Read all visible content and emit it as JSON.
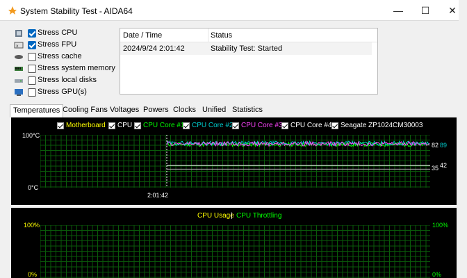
{
  "window": {
    "title": "System Stability Test - AIDA64",
    "minimize": "—",
    "maximize": "☐",
    "close": "✕"
  },
  "options": [
    {
      "label": "Stress CPU",
      "checked": true,
      "icon": "cpu-icon"
    },
    {
      "label": "Stress FPU",
      "checked": true,
      "icon": "fpu-icon"
    },
    {
      "label": "Stress cache",
      "checked": false,
      "icon": "cache-icon"
    },
    {
      "label": "Stress system memory",
      "checked": false,
      "icon": "memory-icon"
    },
    {
      "label": "Stress local disks",
      "checked": false,
      "icon": "disk-icon"
    },
    {
      "label": "Stress GPU(s)",
      "checked": false,
      "icon": "gpu-icon"
    }
  ],
  "log": {
    "headers": [
      "Date / Time",
      "Status"
    ],
    "rows": [
      [
        "2024/9/24 2:01:42",
        "Stability Test: Started"
      ]
    ]
  },
  "tabs": [
    "Temperatures",
    "Cooling Fans",
    "Voltages",
    "Powers",
    "Clocks",
    "Unified",
    "Statistics"
  ],
  "active_tab": "Temperatures",
  "temp_chart": {
    "legend": [
      {
        "label": "Motherboard",
        "color": "#ffff00"
      },
      {
        "label": "CPU",
        "color": "#ffffff"
      },
      {
        "label": "CPU Core #1",
        "color": "#00ff00"
      },
      {
        "label": "CPU Core #2",
        "color": "#00cccc"
      },
      {
        "label": "CPU Core #3",
        "color": "#ff44ff"
      },
      {
        "label": "CPU Core #4",
        "color": "#ffffff"
      },
      {
        "label": "Seagate ZP1024CM30003",
        "color": "#ffffff"
      }
    ],
    "y_top": "100°C",
    "y_bottom": "0°C",
    "x_label": "2:01:42",
    "right_values": [
      "82",
      "89",
      "35",
      "42"
    ]
  },
  "usage_chart": {
    "title_a": "CPU Usage",
    "title_sep": "|",
    "title_b": "CPU Throttling",
    "y_top_left": "100%",
    "y_top_right": "100%",
    "y_bottom_left": "0%",
    "y_bottom_right": "0%"
  },
  "chart_data": {
    "type": "line",
    "title": "",
    "ylabel": "",
    "ylim": [
      0,
      100
    ],
    "x": [
      "2:01:42"
    ],
    "series": [
      {
        "name": "CPU Core #1",
        "values": [
          82
        ]
      },
      {
        "name": "CPU Core #2",
        "values": [
          89
        ]
      },
      {
        "name": "Motherboard",
        "values": [
          35
        ]
      },
      {
        "name": "Seagate ZP1024CM30003",
        "values": [
          42
        ]
      }
    ]
  }
}
